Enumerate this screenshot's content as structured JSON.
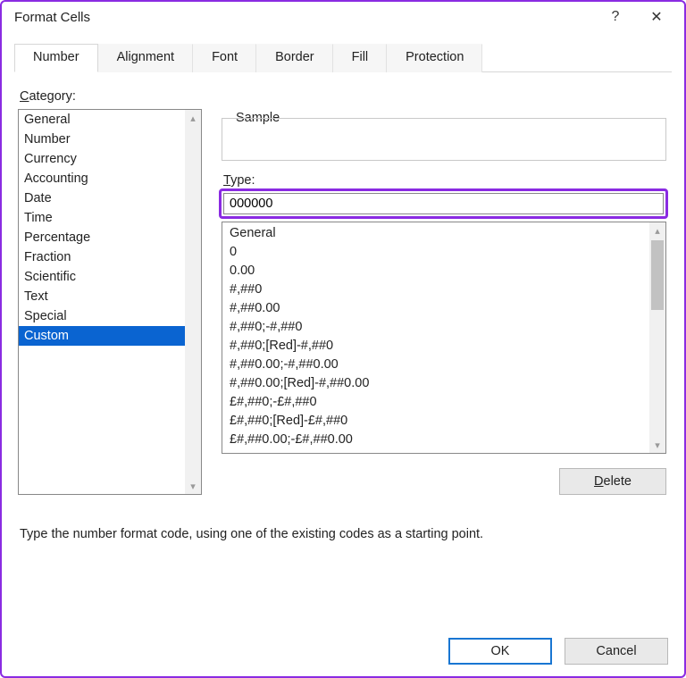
{
  "titlebar": {
    "title": "Format Cells",
    "help": "?",
    "close": "✕"
  },
  "tabs": [
    {
      "label": "Number",
      "active": true
    },
    {
      "label": "Alignment",
      "active": false
    },
    {
      "label": "Font",
      "active": false
    },
    {
      "label": "Border",
      "active": false
    },
    {
      "label": "Fill",
      "active": false
    },
    {
      "label": "Protection",
      "active": false
    }
  ],
  "category_label_pre": "",
  "category_label_u": "C",
  "category_label_post": "ategory:",
  "categories": [
    "General",
    "Number",
    "Currency",
    "Accounting",
    "Date",
    "Time",
    "Percentage",
    "Fraction",
    "Scientific",
    "Text",
    "Special",
    "Custom"
  ],
  "selected_category_index": 11,
  "sample": {
    "label": "Sample",
    "value": ""
  },
  "type": {
    "label_u": "T",
    "label_post": "ype:",
    "value": "000000"
  },
  "format_codes": [
    "General",
    "0",
    "0.00",
    "#,##0",
    "#,##0.00",
    "#,##0;-#,##0",
    "#,##0;[Red]-#,##0",
    "#,##0.00;-#,##0.00",
    "#,##0.00;[Red]-#,##0.00",
    "£#,##0;-£#,##0",
    "£#,##0;[Red]-£#,##0",
    "£#,##0.00;-£#,##0.00"
  ],
  "delete_label_u": "D",
  "delete_label_post": "elete",
  "help_text": "Type the number format code, using one of the existing codes as a starting point.",
  "buttons": {
    "ok": "OK",
    "cancel": "Cancel"
  }
}
